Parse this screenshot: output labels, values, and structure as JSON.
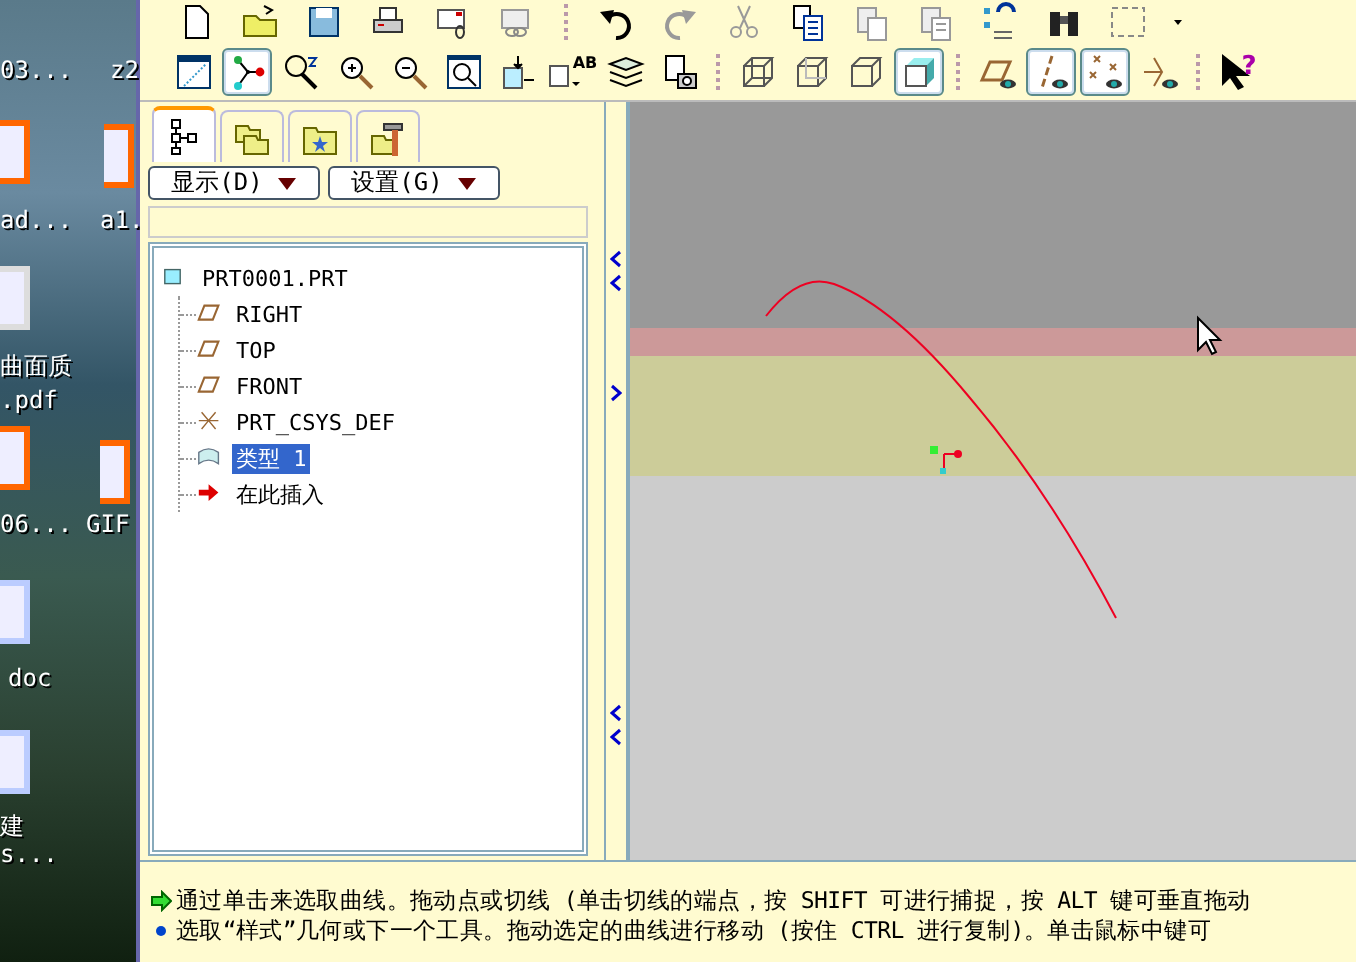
{
  "desktop": {
    "icons": [
      {
        "label": "03..."
      },
      {
        "label": "z2"
      },
      {
        "label": "ad...",
        "kind": "app"
      },
      {
        "label": "a1.",
        "kind": "app"
      },
      {
        "label": "曲面质",
        "kind": "pdf"
      },
      {
        "label": ".pdf"
      },
      {
        "label": "06...",
        "kind": "app"
      },
      {
        "label": "GIF",
        "kind": "app"
      },
      {
        "label": "doc",
        "kind": "doc"
      },
      {
        "label": "建",
        "kind": "doc"
      },
      {
        "label": "s..."
      }
    ]
  },
  "toolbars": [
    {
      "buttons": [
        {
          "kind": "new",
          "selected": false
        },
        {
          "kind": "open",
          "selected": false
        },
        {
          "kind": "save",
          "selected": false
        },
        {
          "kind": "print",
          "selected": false
        },
        {
          "kind": "mail",
          "selected": false
        },
        {
          "kind": "mail-link",
          "selected": false
        },
        {
          "kind": "sep"
        },
        {
          "kind": "undo",
          "selected": false
        },
        {
          "kind": "redo",
          "selected": false
        },
        {
          "kind": "cut",
          "selected": false
        },
        {
          "kind": "copy",
          "selected": false
        },
        {
          "kind": "paste",
          "selected": false
        },
        {
          "kind": "paste-special",
          "selected": false
        },
        {
          "kind": "regen",
          "selected": false
        },
        {
          "kind": "find",
          "selected": false
        },
        {
          "kind": "select-box",
          "selected": false
        },
        {
          "kind": "caret",
          "selected": false
        }
      ]
    },
    {
      "buttons": [
        {
          "kind": "sketch-view",
          "selected": false
        },
        {
          "kind": "nodes",
          "selected": true
        },
        {
          "kind": "refit",
          "selected": false
        },
        {
          "kind": "zoom-in",
          "selected": false
        },
        {
          "kind": "zoom-out",
          "selected": false
        },
        {
          "kind": "zoom-box",
          "selected": false
        },
        {
          "kind": "orient",
          "selected": false
        },
        {
          "kind": "named-view",
          "label": "AB",
          "selected": false
        },
        {
          "kind": "layers",
          "selected": false
        },
        {
          "kind": "snapshot",
          "selected": false
        },
        {
          "kind": "sep"
        },
        {
          "kind": "wireframe",
          "selected": false
        },
        {
          "kind": "hidden",
          "selected": false
        },
        {
          "kind": "no-hidden",
          "selected": false
        },
        {
          "kind": "shaded",
          "selected": true
        },
        {
          "kind": "sep"
        },
        {
          "kind": "plane",
          "selected": false
        },
        {
          "kind": "axis",
          "selected": true
        },
        {
          "kind": "points",
          "selected": true
        },
        {
          "kind": "csys",
          "selected": false
        },
        {
          "kind": "sep"
        },
        {
          "kind": "help",
          "label": "?",
          "selected": false
        }
      ]
    }
  ],
  "panel": {
    "tabs": [
      {
        "kind": "tree",
        "selected": true
      },
      {
        "kind": "folders",
        "selected": false
      },
      {
        "kind": "favorites",
        "selected": false
      },
      {
        "kind": "tools",
        "selected": false
      }
    ],
    "menus": [
      {
        "label": "显示(D)"
      },
      {
        "label": "设置(G)"
      }
    ],
    "tree": {
      "label": "PRT0001.PRT",
      "kind": "part",
      "selected": false,
      "children": [
        {
          "label": "RIGHT",
          "kind": "plane",
          "selected": false
        },
        {
          "label": "TOP",
          "kind": "plane",
          "selected": false
        },
        {
          "label": "FRONT",
          "kind": "plane",
          "selected": false
        },
        {
          "label": "PRT_CSYS_DEF",
          "kind": "csys",
          "selected": false
        },
        {
          "label": "类型 1",
          "kind": "surface",
          "selected": true
        },
        {
          "label": "在此插入",
          "kind": "insert",
          "selected": false
        }
      ]
    }
  },
  "status": {
    "messages": [
      {
        "kind": "prompt",
        "text": "通过单击来选取曲线。拖动点或切线 (单击切线的端点，按 SHIFT 可进行捕捉，按 ALT 键可垂直拖动"
      },
      {
        "kind": "info",
        "text": "选取“样式”几何或下一个工具。拖动选定的曲线进行移动 (按住 CTRL 进行复制)。单击鼠标中键可"
      }
    ]
  }
}
